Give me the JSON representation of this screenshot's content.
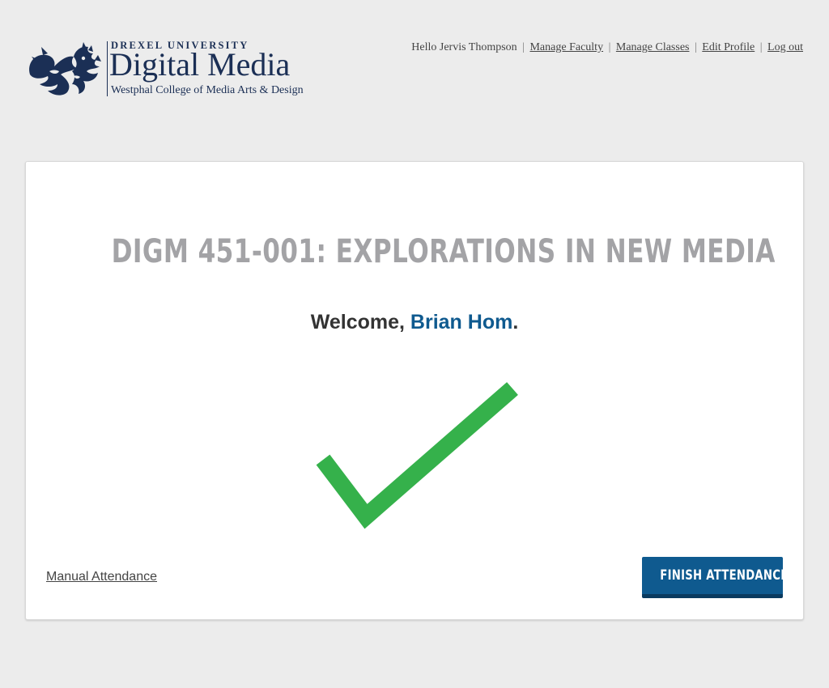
{
  "logo": {
    "university": "DREXEL UNIVERSITY",
    "program": "Digital Media",
    "college": "Westphal College of Media Arts & Design",
    "icon": "dragon-icon"
  },
  "nav": {
    "greeting": "Hello Jervis Thompson",
    "separator": "|",
    "links": [
      "Manage Faculty",
      "Manage Classes",
      "Edit Profile",
      "Log out"
    ]
  },
  "attendance": {
    "course_title": "DIGM 451-001: EXPLORATIONS IN NEW MEDIA",
    "welcome_prefix": "Welcome, ",
    "student_name": "Brian Hom",
    "welcome_suffix": ".",
    "status_icon": "checkmark-icon",
    "manual_link": "Manual Attendance",
    "finish_button": "FINISH ATTENDANCE"
  },
  "colors": {
    "page_background": "#ececec",
    "brand_navy": "#1b2f55",
    "title_gray": "#a3a3a6",
    "name_blue": "#0f5a8f",
    "check_green": "#35b14b",
    "button_blue": "#0f5a8f"
  }
}
